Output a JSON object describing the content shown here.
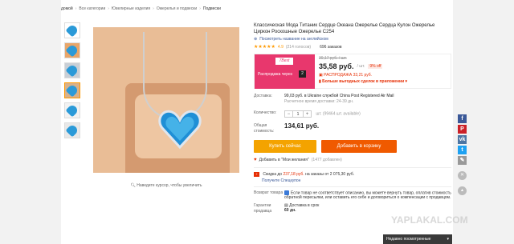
{
  "breadcrumb": [
    "домой",
    "Все категории",
    "Ювелирные изделия",
    "Ожерелья и подвески",
    "Подвески"
  ],
  "thumbnails": [
    "thumb-1",
    "thumb-2",
    "thumb-3",
    "thumb-4",
    "thumb-5",
    "thumb-6"
  ],
  "zoom_hint": "Наведите курсор, чтобы увеличить",
  "product": {
    "title": "Классическая Мода Титаник Сердце Океана Ожерелье Сердца Кулон Ожерелье Циркон Роскошные Ожерелье C254",
    "share": "Посмотреть название на английском",
    "rating": "4.9",
    "votes": "(214 голосов)",
    "orders": "696 заказов"
  },
  "promo": {
    "logo": "7Best",
    "timer_label": "Распродажа через",
    "days": "2",
    "old_price": "39,17 руб. / шт.",
    "new_price": "35,58 руб.",
    "unit": "/ шт.",
    "discount": "9% off",
    "sale": "РАСПРОДАЖА 33,21 руб.",
    "app_deal": "Больше выгодных сделок в приложении"
  },
  "shipping": {
    "label": "Доставка:",
    "main": "99,03 руб. в Ukraine службой China Post Registered Air Mail",
    "sub": "Расчетное время доставки: 24-39 дн."
  },
  "quantity": {
    "label": "Количество:",
    "value": "1",
    "minus": "−",
    "plus": "+",
    "avail": "шт. (99464 шт. available)"
  },
  "total": {
    "label": "Общая стоимость:",
    "value": "134,61 руб."
  },
  "buttons": {
    "buy": "Купить сейчас",
    "cart": "Добавить в корзину"
  },
  "wishlist": {
    "label": "Добавить в \"Мои желания\"",
    "count": "(1477 добавлен)"
  },
  "coupon": {
    "text_prefix": "Скидка до",
    "amount": "237,18 руб.",
    "text_suffix": "на заказы от 2 075,30 руб.",
    "link": "Получите Спецкупон"
  },
  "returns": {
    "label": "Возврат товара",
    "text": "Если товар не соответствует описанию, вы можете вернуть товар, оплатив стоимость обратной пересылки, или оставить его себе и договориться о компенсации с продавцом."
  },
  "guarantee": {
    "label": "Гарантии продавца",
    "text": "Доставка в срок",
    "days": "60 дн."
  },
  "social": [
    "f",
    "P",
    "vk",
    "t",
    "✎"
  ],
  "recent": {
    "label": "Недавно посмотренные",
    "arrow": "▾"
  },
  "watermark": "YAPLAKAL.COM",
  "colors": {
    "accent_orange": "#f4a300",
    "cart_orange": "#f05a00",
    "sale_red": "#e62e04",
    "promo_pink": "#e8376d"
  }
}
